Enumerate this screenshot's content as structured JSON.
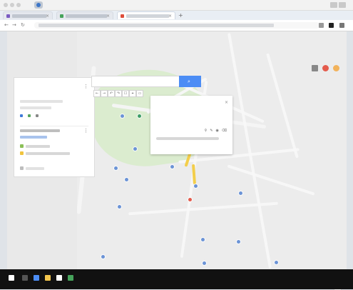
{
  "browser": {
    "profile_name": "",
    "tabs": [
      {
        "title": ""
      },
      {
        "title": ""
      },
      {
        "title": ""
      }
    ],
    "url": ""
  },
  "map": {
    "search_placeholder": "",
    "tool_labels": [
      "←",
      "→",
      "↶",
      "↷",
      "☐",
      "⌖",
      "▭"
    ],
    "labels": [
      "",
      "",
      "",
      "",
      "",
      "",
      "",
      "",
      "",
      "",
      "",
      ""
    ]
  },
  "side_panel": {
    "title": "",
    "subtitle": "",
    "row1": "",
    "row2": "",
    "actions": [
      "",
      "",
      ""
    ],
    "layer_title": "",
    "layer_link": "",
    "items": [
      {
        "label": "",
        "count": ""
      },
      {
        "label": "",
        "count": ""
      }
    ],
    "base_map": ""
  },
  "info_card": {
    "title": "",
    "meta": ""
  },
  "taskbar": {
    "time": "",
    "date": ""
  },
  "colors": {
    "accent": "#4c8df5",
    "route": "#f3ce4b",
    "park": "#dbeccf",
    "pin_blue": "#6b93d6",
    "pin_red": "#e45b4c"
  }
}
